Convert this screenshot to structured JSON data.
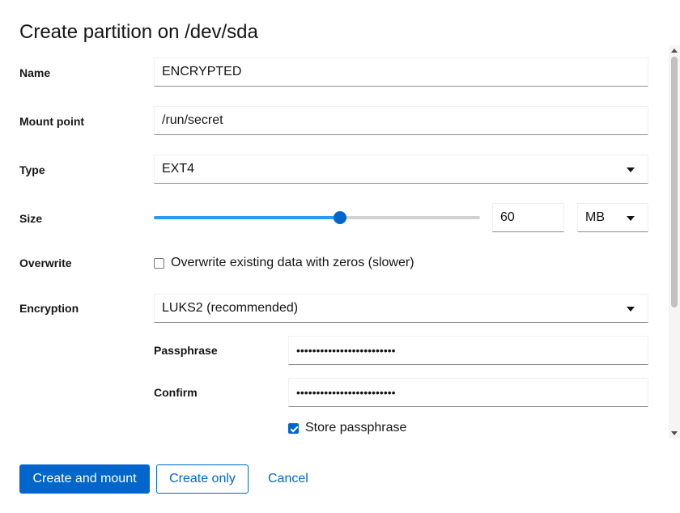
{
  "dialog": {
    "title": "Create partition on /dev/sda"
  },
  "form": {
    "name": {
      "label": "Name",
      "value": "ENCRYPTED"
    },
    "mount_point": {
      "label": "Mount point",
      "value": "/run/secret"
    },
    "type": {
      "label": "Type",
      "selected": "EXT4"
    },
    "size": {
      "label": "Size",
      "value": "60",
      "unit": "MB",
      "slider_fraction": 0.57
    },
    "overwrite": {
      "label": "Overwrite",
      "checkbox_label": "Overwrite existing data with zeros (slower)",
      "checked": false
    },
    "encryption": {
      "label": "Encryption",
      "selected": "LUKS2 (recommended)",
      "passphrase": {
        "label": "Passphrase",
        "masked_value": "•••••••••••••••••••••••••"
      },
      "confirm": {
        "label": "Confirm",
        "masked_value": "•••••••••••••••••••••••••"
      },
      "store": {
        "label": "Store passphrase",
        "checked": true
      }
    }
  },
  "icons": {
    "dropdown": "caret-down-icon",
    "check": "check-icon"
  },
  "colors": {
    "primary": "#0066cc",
    "slider_fill": "#2b9af3",
    "text": "#151515"
  },
  "actions": {
    "create_and_mount": "Create and mount",
    "create_only": "Create only",
    "cancel": "Cancel"
  }
}
